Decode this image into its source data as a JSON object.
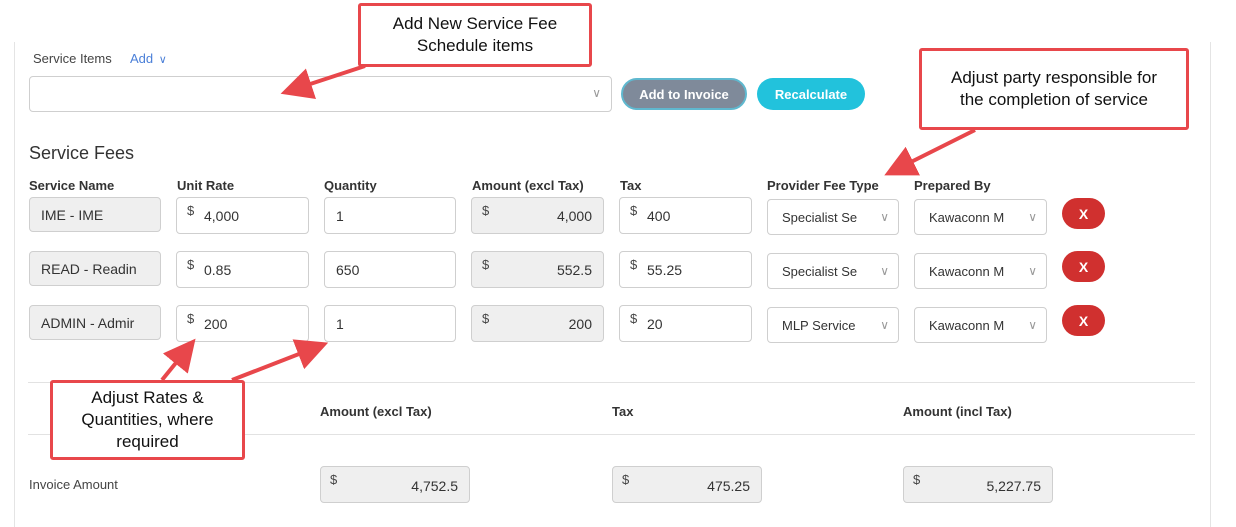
{
  "service_items": {
    "label": "Service Items",
    "add_label": "Add",
    "select_value": "",
    "add_to_invoice_label": "Add to Invoice",
    "recalculate_label": "Recalculate"
  },
  "service_fees": {
    "title": "Service Fees",
    "columns": [
      "Service Name",
      "Unit Rate",
      "Quantity",
      "Amount (excl Tax)",
      "Tax",
      "Provider Fee Type",
      "Prepared By"
    ],
    "currency_symbol": "$",
    "rows": [
      {
        "service_name": "IME - IME",
        "unit_rate": "4,000",
        "quantity": "1",
        "amount": "4,000",
        "tax": "400",
        "provider_fee_type": "Specialist Se",
        "prepared_by": "Kawaconn M",
        "remove_label": "X"
      },
      {
        "service_name": "READ - Readin",
        "unit_rate": "0.85",
        "quantity": "650",
        "amount": "552.5",
        "tax": "55.25",
        "provider_fee_type": "Specialist Se",
        "prepared_by": "Kawaconn M",
        "remove_label": "X"
      },
      {
        "service_name": "ADMIN - Admir",
        "unit_rate": "200",
        "quantity": "1",
        "amount": "200",
        "tax": "20",
        "provider_fee_type": "MLP Service",
        "prepared_by": "Kawaconn M",
        "remove_label": "X"
      }
    ]
  },
  "summary": {
    "headers": [
      "Amount (excl Tax)",
      "Tax",
      "Amount (incl Tax)"
    ],
    "row_label": "Invoice Amount",
    "amount_excl": "4,752.5",
    "tax": "475.25",
    "amount_incl": "5,227.75"
  },
  "callouts": {
    "add_items": [
      "Add New Service Fee",
      "Schedule items"
    ],
    "party": [
      "Adjust party responsible for",
      "the completion of service"
    ],
    "rates": [
      "Adjust Rates &",
      "Quantities, where",
      "required"
    ]
  },
  "colors": {
    "callout_border": "#e8474b",
    "remove_button": "#d0302f",
    "recalculate_button": "#22c2dc",
    "add_to_invoice_button": "#7f8a9a",
    "link": "#4a7fd8"
  }
}
